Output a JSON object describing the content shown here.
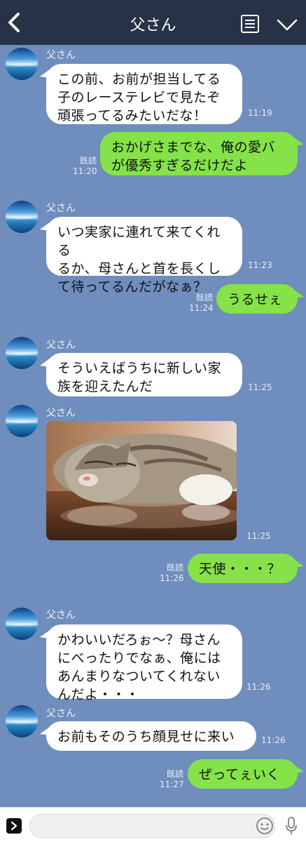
{
  "header": {
    "title": "父さん"
  },
  "messages": [
    {
      "sender": "父さん",
      "text": "この前、お前が担当してる\n子のレーステレビで見たぞ\n頑張ってるみたいだな！",
      "time": "11:19"
    },
    {
      "text": "おかげさまでな、俺の愛バ\nが優秀すぎるだけだよ",
      "read": "既読",
      "time": "11:20"
    },
    {
      "sender": "父さん",
      "text": "いつ実家に連れて来てくれる\nるか、母さんと首を長くし\nて待ってるんだがなぁ？",
      "time": "11:23"
    },
    {
      "text": "うるせぇ",
      "read": "既読",
      "time": "11:24"
    },
    {
      "sender": "父さん",
      "text": "そういえばうちに新しい家\n族を迎えたんだ",
      "time": "11:25"
    },
    {
      "sender": "父さん",
      "image": "sleeping-cat-photo",
      "time": "11:25"
    },
    {
      "text": "天使・・・？",
      "read": "既読",
      "time": "11:26"
    },
    {
      "sender": "父さん",
      "text": "かわいいだろぉ〜？母さん\nにべったりでなぁ、俺には\nあんまりなついてくれない\nんだよ・・・",
      "time": "11:26"
    },
    {
      "sender": "父さん",
      "text": "お前もそのうち顔見せに来い",
      "time": "11:26"
    },
    {
      "text": "ぜってぇいく",
      "read": "既読",
      "time": "11:27"
    }
  ],
  "input": {
    "placeholder": ""
  },
  "colors": {
    "background": "#6f8dbd",
    "header": "#273246",
    "outgoing": "#85e249",
    "incoming": "#ffffff"
  }
}
